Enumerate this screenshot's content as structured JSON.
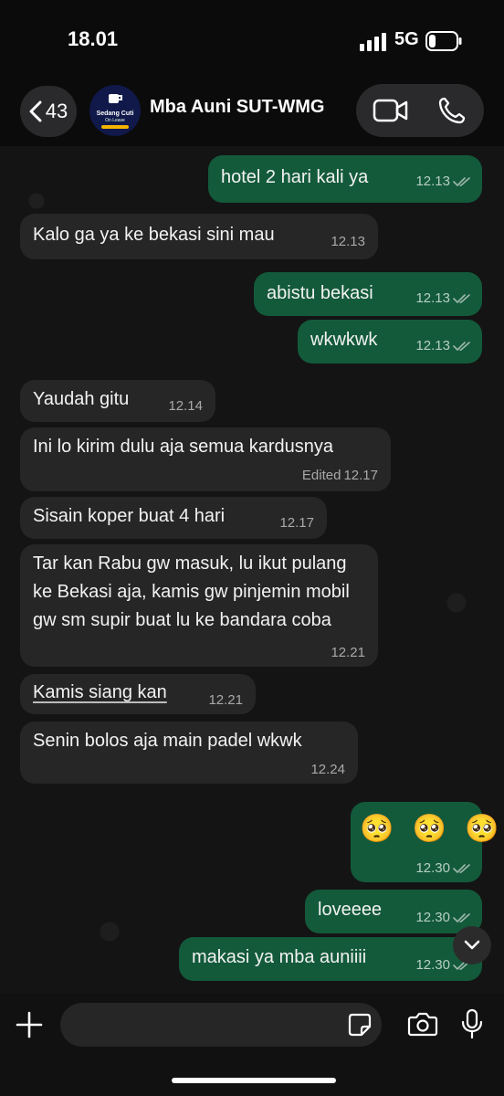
{
  "status_bar": {
    "time": "18.01",
    "network": "5G",
    "signal_icon": "signal-bars-icon",
    "battery_icon": "battery-low-icon"
  },
  "header": {
    "back_count": "43",
    "contact_name": "Mba Auni SUT-WMG",
    "avatar_text": {
      "line1": "Sedang Cuti",
      "line2": "On Leave"
    }
  },
  "messages": [
    {
      "dir": "out",
      "text": "hotel 2 hari kali ya",
      "time": "12.13",
      "read": true
    },
    {
      "dir": "in",
      "text": "Kalo ga ya ke bekasi sini mau",
      "time": "12.13"
    },
    {
      "dir": "out",
      "text": "abistu bekasi",
      "time": "12.13",
      "read": true
    },
    {
      "dir": "out",
      "text": "wkwkwk",
      "time": "12.13",
      "read": true
    },
    {
      "dir": "in",
      "text": "Yaudah gitu",
      "time": "12.14"
    },
    {
      "dir": "in",
      "text": "Ini lo kirim dulu aja semua kardusnya",
      "time": "12.17",
      "edited": "Edited"
    },
    {
      "dir": "in",
      "text": "Sisain koper buat 4 hari",
      "time": "12.17"
    },
    {
      "dir": "in",
      "text": "Tar kan Rabu gw masuk, lu ikut pulang ke Bekasi aja, kamis gw pinjemin mobil gw sm supir buat lu ke bandara coba",
      "time": "12.21"
    },
    {
      "dir": "in",
      "text": "Kamis siang kan",
      "time": "12.21"
    },
    {
      "dir": "in",
      "text": "Senin bolos aja main padel wkwk",
      "time": "12.24"
    },
    {
      "dir": "out",
      "text": "🥺 🥺 🥺",
      "time": "12.30",
      "read": true
    },
    {
      "dir": "out",
      "text": "loveeee",
      "time": "12.30",
      "read": true
    },
    {
      "dir": "out",
      "text": "makasi ya mba auniiii",
      "time": "12.30",
      "read": true
    }
  ],
  "input": {
    "placeholder": ""
  },
  "colors": {
    "outgoing": "#135a3b",
    "incoming": "#262626",
    "background": "#141414",
    "read_ticks": "#9fb8ac"
  }
}
